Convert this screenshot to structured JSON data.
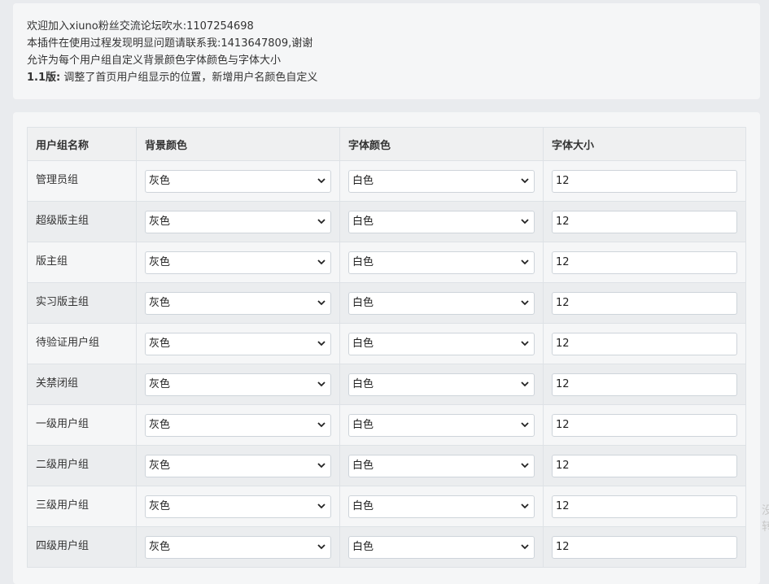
{
  "info": {
    "line1": "欢迎加入xiuno粉丝交流论坛吹水:1107254698",
    "line2": "本插件在使用过程发现明显问题请联系我:1413647809,谢谢",
    "line3": "允许为每个用户组自定义背景颜色字体颜色与字体大小",
    "version_label": "1.1版:",
    "version_text": "调整了首页用户组显示的位置，新增用户名颜色自定义"
  },
  "table": {
    "headers": [
      "用户组名称",
      "背景颜色",
      "字体颜色",
      "字体大小"
    ],
    "rows": [
      {
        "name": "管理员组",
        "bg": "灰色",
        "fg": "白色",
        "size": "12"
      },
      {
        "name": "超级版主组",
        "bg": "灰色",
        "fg": "白色",
        "size": "12"
      },
      {
        "name": "版主组",
        "bg": "灰色",
        "fg": "白色",
        "size": "12"
      },
      {
        "name": "实习版主组",
        "bg": "灰色",
        "fg": "白色",
        "size": "12"
      },
      {
        "name": "待验证用户组",
        "bg": "灰色",
        "fg": "白色",
        "size": "12"
      },
      {
        "name": "关禁闭组",
        "bg": "灰色",
        "fg": "白色",
        "size": "12"
      },
      {
        "name": "一级用户组",
        "bg": "灰色",
        "fg": "白色",
        "size": "12"
      },
      {
        "name": "二级用户组",
        "bg": "灰色",
        "fg": "白色",
        "size": "12"
      },
      {
        "name": "三级用户组",
        "bg": "灰色",
        "fg": "白色",
        "size": "12"
      },
      {
        "name": "四级用户组",
        "bg": "灰色",
        "fg": "白色",
        "size": "12"
      }
    ]
  },
  "icons": {
    "select_arrow": "chevron-down-icon"
  },
  "side_text": "没\n转"
}
